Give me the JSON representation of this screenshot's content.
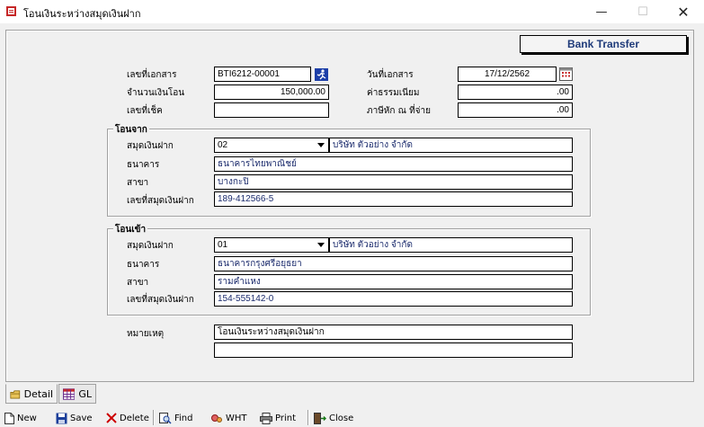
{
  "window": {
    "title": "โอนเงินระหว่างสมุดเงินฝาก",
    "minimize": "—",
    "maximize": "☐",
    "close": "✕"
  },
  "badge": "Bank Transfer",
  "header": {
    "doc_no_label": "เลขที่เอกสาร",
    "doc_no": "BTI6212-00001",
    "doc_date_label": "วันที่เอกสาร",
    "doc_date": "17/12/2562",
    "amount_label": "จำนวนเงินโอน",
    "amount": "150,000.00",
    "fee_label": "ค่าธรรมเนียม",
    "fee": ".00",
    "cheque_label": "เลขที่เช็ค",
    "cheque": "",
    "wht_label": "ภาษีหัก ณ ที่จ่าย",
    "wht": ".00"
  },
  "from": {
    "title": "โอนจาก",
    "book_label": "สมุดเงินฝาก",
    "book_code": "02",
    "book_name": "บริษัท ตัวอย่าง จำกัด",
    "bank_label": "ธนาคาร",
    "bank": "ธนาคารไทยพาณิชย์",
    "branch_label": "สาขา",
    "branch": "บางกะปิ",
    "account_label": "เลขที่สมุดเงินฝาก",
    "account": "189-412566-5"
  },
  "to": {
    "title": "โอนเข้า",
    "book_label": "สมุดเงินฝาก",
    "book_code": "01",
    "book_name": "บริษัท ตัวอย่าง จำกัด",
    "bank_label": "ธนาคาร",
    "bank": "ธนาคารกรุงศรีอยุธยา",
    "branch_label": "สาขา",
    "branch": "รามคำแหง",
    "account_label": "เลขที่สมุดเงินฝาก",
    "account": "154-555142-0"
  },
  "remark": {
    "label": "หมายเหตุ",
    "line1": "โอนเงินระหว่างสมุดเงินฝาก",
    "line2": ""
  },
  "tabs": [
    {
      "label": "Detail",
      "icon": "detail-icon"
    },
    {
      "label": "GL",
      "icon": "grid-icon"
    }
  ],
  "toolbar": {
    "new": "New",
    "save": "Save",
    "delete": "Delete",
    "find": "Find",
    "wht": "WHT",
    "print": "Print",
    "close": "Close"
  },
  "colors": {
    "accent_text": "#1f3b7a",
    "delete_red": "#cc0000",
    "save_blue": "#1b3f9a"
  }
}
